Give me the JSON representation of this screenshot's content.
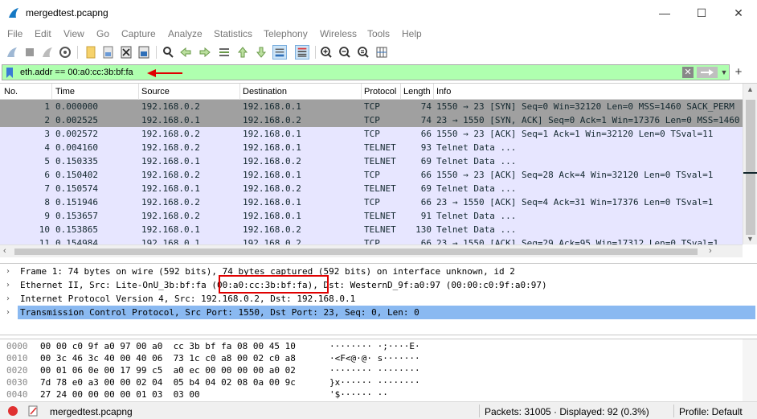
{
  "window": {
    "title": "mergedtest.pcapng",
    "minimize": "—",
    "maximize": "☐",
    "close": "✕"
  },
  "menu": [
    "File",
    "Edit",
    "View",
    "Go",
    "Capture",
    "Analyze",
    "Statistics",
    "Telephony",
    "Wireless",
    "Tools",
    "Help"
  ],
  "filter": {
    "value": "eth.addr == 00:a0:cc:3b:bf:fa",
    "bg_color": "#afffaf"
  },
  "packet_list": {
    "columns": [
      "No.",
      "Time",
      "Source",
      "Destination",
      "Protocol",
      "Length",
      "Info"
    ],
    "rows": [
      {
        "no": "1",
        "time": "0.000000",
        "src": "192.168.0.2",
        "dst": "192.168.0.1",
        "proto": "TCP",
        "len": "74",
        "info": "1550 → 23 [SYN] Seq=0 Win=32120 Len=0 MSS=1460 SACK_PERM",
        "bg": "#a0a0a0"
      },
      {
        "no": "2",
        "time": "0.002525",
        "src": "192.168.0.1",
        "dst": "192.168.0.2",
        "proto": "TCP",
        "len": "74",
        "info": "23 → 1550 [SYN, ACK] Seq=0 Ack=1 Win=17376 Len=0 MSS=1460",
        "bg": "#a0a0a0"
      },
      {
        "no": "3",
        "time": "0.002572",
        "src": "192.168.0.2",
        "dst": "192.168.0.1",
        "proto": "TCP",
        "len": "66",
        "info": "1550 → 23 [ACK] Seq=1 Ack=1 Win=32120 Len=0 TSval=11",
        "bg": "#e7e6ff"
      },
      {
        "no": "4",
        "time": "0.004160",
        "src": "192.168.0.2",
        "dst": "192.168.0.1",
        "proto": "TELNET",
        "len": "93",
        "info": "Telnet Data ...",
        "bg": "#e7e6ff"
      },
      {
        "no": "5",
        "time": "0.150335",
        "src": "192.168.0.1",
        "dst": "192.168.0.2",
        "proto": "TELNET",
        "len": "69",
        "info": "Telnet Data ...",
        "bg": "#e7e6ff"
      },
      {
        "no": "6",
        "time": "0.150402",
        "src": "192.168.0.2",
        "dst": "192.168.0.1",
        "proto": "TCP",
        "len": "66",
        "info": "1550 → 23 [ACK] Seq=28 Ack=4 Win=32120 Len=0 TSval=1",
        "bg": "#e7e6ff"
      },
      {
        "no": "7",
        "time": "0.150574",
        "src": "192.168.0.1",
        "dst": "192.168.0.2",
        "proto": "TELNET",
        "len": "69",
        "info": "Telnet Data ...",
        "bg": "#e7e6ff"
      },
      {
        "no": "8",
        "time": "0.151946",
        "src": "192.168.0.2",
        "dst": "192.168.0.1",
        "proto": "TCP",
        "len": "66",
        "info": "23 → 1550 [ACK] Seq=4 Ack=31 Win=17376 Len=0 TSval=1",
        "bg": "#e7e6ff"
      },
      {
        "no": "9",
        "time": "0.153657",
        "src": "192.168.0.2",
        "dst": "192.168.0.1",
        "proto": "TELNET",
        "len": "91",
        "info": "Telnet Data ...",
        "bg": "#e7e6ff"
      },
      {
        "no": "10",
        "time": "0.153865",
        "src": "192.168.0.1",
        "dst": "192.168.0.2",
        "proto": "TELNET",
        "len": "130",
        "info": "Telnet Data ...",
        "bg": "#e7e6ff"
      },
      {
        "no": "11",
        "time": "0.154984",
        "src": "192.168.0.1",
        "dst": "192.168.0.2",
        "proto": "TCP",
        "len": "66",
        "info": "23 → 1550 [ACK] Seq=29 Ack=95 Win=17312 Len=0 TSval=1",
        "bg": "#e7e6ff"
      }
    ]
  },
  "details": [
    {
      "text": "Frame 1: 74 bytes on wire (592 bits), 74 bytes captured (592 bits) on interface unknown, id 2",
      "selected": false
    },
    {
      "text": "Ethernet II, Src: Lite-OnU_3b:bf:fa (00:a0:cc:3b:bf:fa), Dst: WesternD_9f:a0:97 (00:00:c0:9f:a0:97)",
      "selected": false
    },
    {
      "text": "Internet Protocol Version 4, Src: 192.168.0.2, Dst: 192.168.0.1",
      "selected": false
    },
    {
      "text": "Transmission Control Protocol, Src Port: 1550, Dst Port: 23, Seq: 0, Len: 0",
      "selected": true
    }
  ],
  "bytes": [
    {
      "off": "0000",
      "hex": "00 00 c0 9f a0 97 00 a0  cc 3b bf fa 08 00 45 10",
      "ascii": "········ ·;····E·"
    },
    {
      "off": "0010",
      "hex": "00 3c 46 3c 40 00 40 06  73 1c c0 a8 00 02 c0 a8",
      "ascii": "·<F<@·@· s·······"
    },
    {
      "off": "0020",
      "hex": "00 01 06 0e 00 17 99 c5  a0 ec 00 00 00 00 a0 02",
      "ascii": "········ ········"
    },
    {
      "off": "0030",
      "hex": "7d 78 e0 a3 00 00 02 04  05 b4 04 02 08 0a 00 9c",
      "ascii": "}x······ ········"
    },
    {
      "off": "0040",
      "hex": "27 24 00 00 00 00 01 03  03 00",
      "ascii": "'$······ ··"
    }
  ],
  "status": {
    "file": "mergedtest.pcapng",
    "packets": "Packets: 31005 · Displayed: 92 (0.3%)",
    "profile": "Profile: Default"
  },
  "colors": {
    "selected_detail": "#8ab9f1",
    "annotation": "#e00000"
  }
}
